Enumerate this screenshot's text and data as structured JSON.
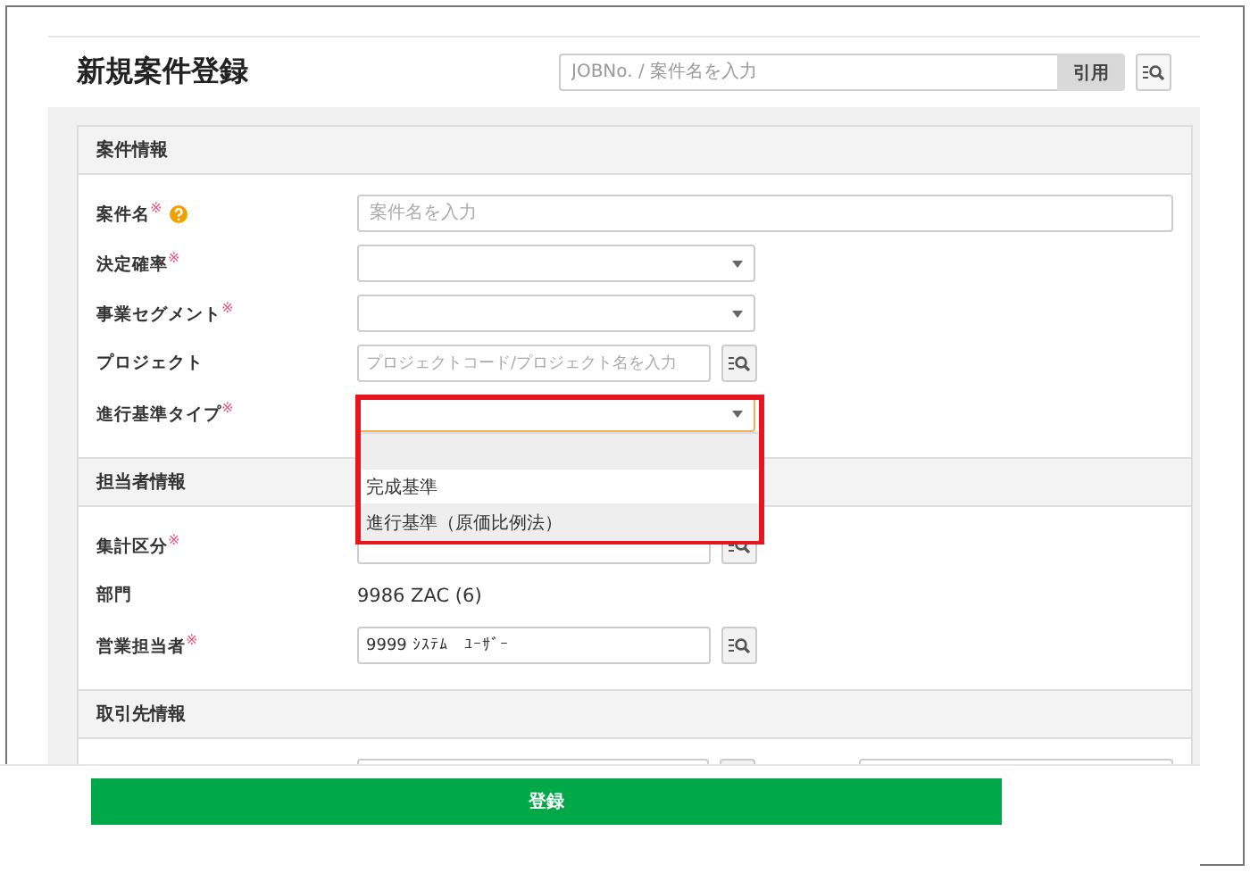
{
  "header": {
    "title": "新規案件登録",
    "search": {
      "placeholder": "JOBNo. / 案件名を入力"
    },
    "quote_button": "引用"
  },
  "sections": [
    {
      "title": "案件情報",
      "rows": [
        {
          "kind": "text",
          "label": "案件名$^{※}$",
          "help": true,
          "placeholder": "案件名を入力"
        },
        {
          "kind": "select",
          "label": "決定確率$^{※}$"
        },
        {
          "kind": "select",
          "label": "事業セグメント$^{※}$"
        },
        {
          "kind": "lookup",
          "label": "プロジェクト",
          "placeholder": "プロジェクトコード/プロジェクト名を入力"
        },
        {
          "kind": "select",
          "label": "進行基準タイプ$^{※}$",
          "expanded": true
        }
      ]
    },
    {
      "title": "担当者情報",
      "rows": [
        {
          "kind": "lookup",
          "label": "集計区分$^{※}$"
        },
        {
          "kind": "static",
          "label": "部門",
          "value": "9986 ZAC (6)"
        },
        {
          "kind": "lookup",
          "label": "営業担当者$^{※}$",
          "value": "9999 ｼｽﾃﾑ　ﾕｰｻﾞｰ"
        }
      ]
    },
    {
      "title": "取引先情報",
      "rows": [
        {
          "kind": "pair"
        }
      ]
    }
  ],
  "dropdown": {
    "blank_option_selected": true,
    "options": [
      {
        "label": "完成基準",
        "hovered": false
      },
      {
        "label": "進行基準（原価比例法）",
        "hovered": true
      }
    ]
  },
  "footer": {
    "submit_button": "登録"
  }
}
